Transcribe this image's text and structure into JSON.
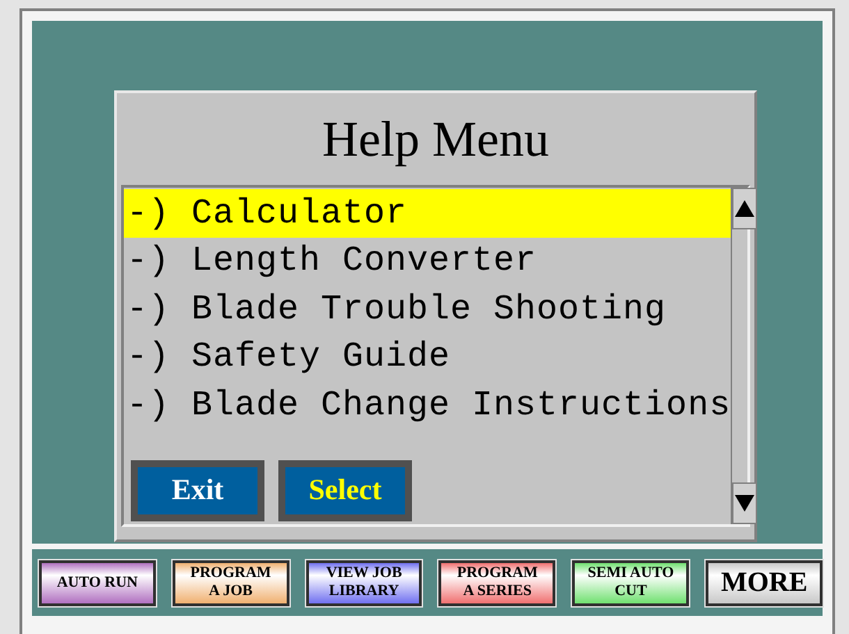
{
  "dialog": {
    "title": "Help Menu",
    "items": [
      {
        "label": "-) Calculator",
        "selected": true
      },
      {
        "label": "-) Length Converter",
        "selected": false
      },
      {
        "label": "-) Blade Trouble Shooting",
        "selected": false
      },
      {
        "label": "-) Safety Guide",
        "selected": false
      },
      {
        "label": "-) Blade Change Instructions",
        "selected": false
      }
    ],
    "buttons": [
      {
        "label": "Exit",
        "kind": "exit"
      },
      {
        "label": "Select",
        "kind": "select"
      }
    ]
  },
  "nav": [
    {
      "label": "AUTO RUN",
      "color": "#b070c0"
    },
    {
      "label": "PROGRAM A JOB",
      "color": "#f0b070"
    },
    {
      "label": "VIEW JOB LIBRARY",
      "color": "#7070f0"
    },
    {
      "label": "PROGRAM A SERIES",
      "color": "#f07070"
    },
    {
      "label": "SEMI AUTO CUT",
      "color": "#70e070"
    },
    {
      "label": "MORE",
      "color": "#c8c8c8"
    }
  ]
}
